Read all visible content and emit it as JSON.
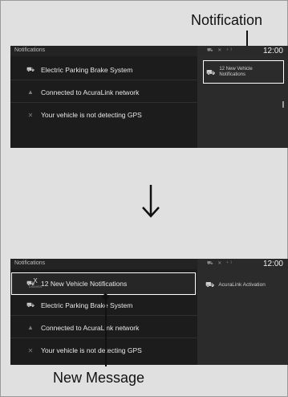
{
  "callouts": {
    "notification": "Notification",
    "new_message": "New Message"
  },
  "screen_top": {
    "header_title": "Notifications",
    "clock": "12:00",
    "status_icons": "⛟ ✕ ⁺¹",
    "rows": [
      {
        "label": "Electric Parking Brake System",
        "icon": "car-warning-icon"
      },
      {
        "label": "Connected to AcuraLink network",
        "icon": "network-icon"
      },
      {
        "label": "Your vehicle is not detecting GPS",
        "icon": "gps-off-icon"
      }
    ],
    "notification_card": {
      "line1": "12 New Vehicle",
      "line2": "Notifications"
    }
  },
  "screen_bottom": {
    "header_title": "Notifications",
    "clock": "12:00",
    "status_icons": "⛟ ✕ ⁺¹",
    "new_row": {
      "label": "12 New Vehicle Notifications",
      "dismiss_mark": "X",
      "dismiss_label": "DISMISS"
    },
    "rows": [
      {
        "label": "Electric Parking Brake System",
        "icon": "car-warning-icon"
      },
      {
        "label": "Connected to AcuraLink network",
        "icon": "network-icon"
      },
      {
        "label": "Your vehicle is not detecting GPS",
        "icon": "gps-off-icon"
      }
    ],
    "right_card": {
      "label": "AcuraLink Activation"
    }
  },
  "arrow": "↓",
  "colors": {
    "screen_bg": "#1c1c1c",
    "pane_bg": "#2b2b2b",
    "highlight_border": "#ffffff"
  }
}
